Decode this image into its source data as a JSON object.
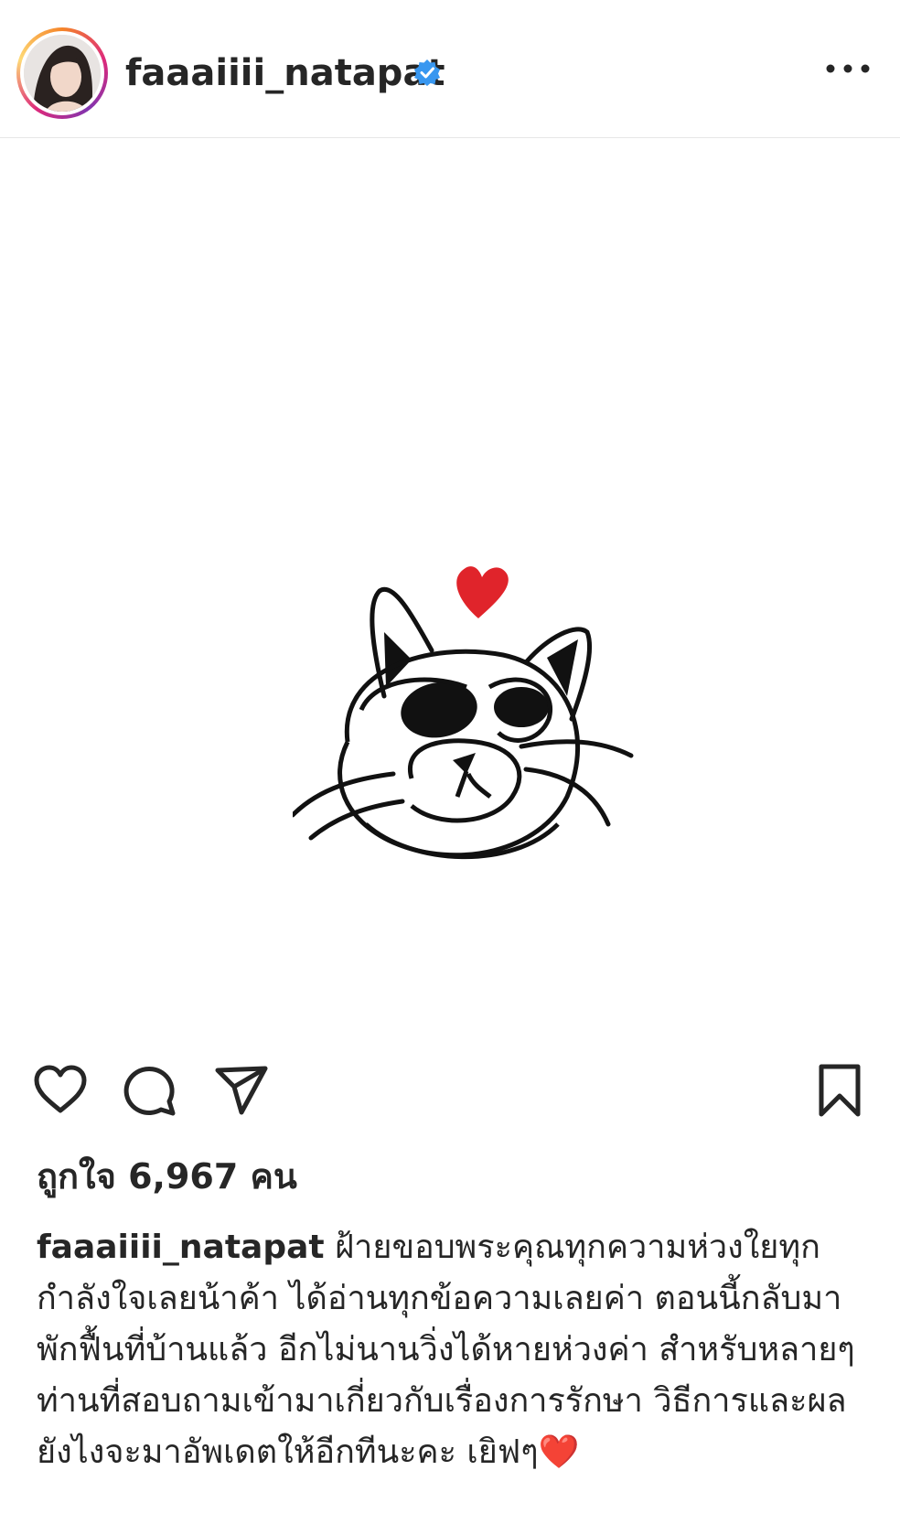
{
  "header": {
    "username": "faaaiiii_natapat",
    "verified_icon": "verified-badge-icon",
    "more_icon": "more-options-icon"
  },
  "post": {
    "image_description_icon": "cat-heart-drawing"
  },
  "actions": {
    "like_icon": "heart-icon",
    "comment_icon": "comment-icon",
    "share_icon": "send-icon",
    "save_icon": "bookmark-icon"
  },
  "likes": {
    "text": "ถูกใจ 6,967 คน"
  },
  "caption": {
    "username": "faaaiiii_natapat",
    "text": "ฝ้ายขอบพระคุณทุกความห่วงใยทุกกำลังใจเลยน้าค้า ได้อ่านทุกข้อความเลยค่า ตอนนี้กลับมาพักฟื้นที่บ้านแล้ว อีกไม่นานวิ่งได้หายห่วงค่า สำหรับหลายๆท่านที่สอบถามเข้ามาเกี่ยวกับเรื่องการรักษา วิธีการและผล ยังไงจะมาอัพเดตให้อีกทีนะคะ เยิฟๆ❤️"
  },
  "colors": {
    "verified": "#3897f0",
    "heart": "#e0242b",
    "text": "#262626"
  }
}
